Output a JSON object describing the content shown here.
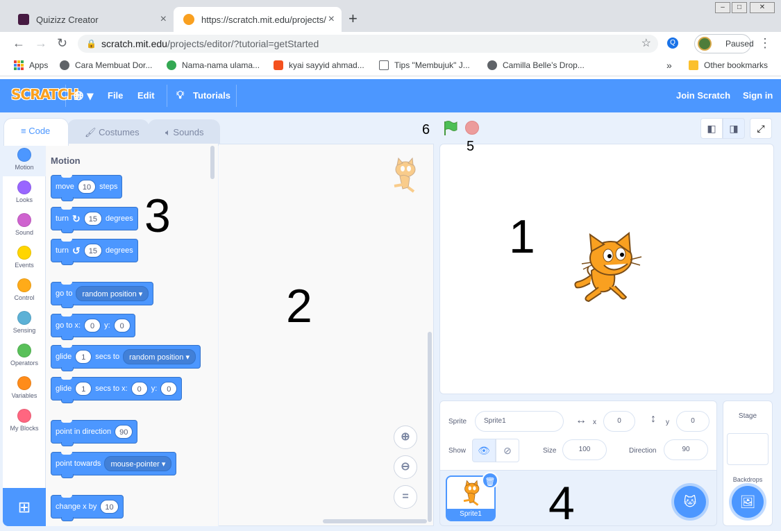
{
  "browser": {
    "tabs": [
      {
        "title": "Quizizz Creator",
        "favicon_color": "#461a42"
      },
      {
        "title": "https://scratch.mit.edu/projects/",
        "favicon_color": "#f9a020"
      }
    ],
    "url_host": "scratch.mit.edu",
    "url_path": "/projects/editor/?tutorial=getStarted",
    "profile_status": "Paused",
    "bookmarks": [
      {
        "label": "Apps"
      },
      {
        "label": "Cara Membuat Dor...",
        "color": "#5f6368"
      },
      {
        "label": "Nama-nama ulama...",
        "color": "#34a853"
      },
      {
        "label": "kyai sayyid ahmad...",
        "color": "#f4511e"
      },
      {
        "label": "Tips \"Membujuk\" J...",
        "color": "#5f6368"
      },
      {
        "label": "Camilla Belle’s Drop...",
        "color": "#5f6368"
      }
    ],
    "other_bookmarks": "Other bookmarks"
  },
  "scratch": {
    "logo": "SCRATCH",
    "menu": {
      "file": "File",
      "edit": "Edit",
      "tutorials": "Tutorials",
      "join": "Join Scratch",
      "signin": "Sign in"
    },
    "editor_tabs": {
      "code": "Code",
      "costumes": "Costumes",
      "sounds": "Sounds"
    },
    "categories": [
      {
        "label": "Motion",
        "color": "#4c97ff"
      },
      {
        "label": "Looks",
        "color": "#9966ff"
      },
      {
        "label": "Sound",
        "color": "#cf63cf"
      },
      {
        "label": "Events",
        "color": "#ffd500"
      },
      {
        "label": "Control",
        "color": "#ffab19"
      },
      {
        "label": "Sensing",
        "color": "#5cb1d6"
      },
      {
        "label": "Operators",
        "color": "#59c059"
      },
      {
        "label": "Variables",
        "color": "#ff8c1a"
      },
      {
        "label": "My Blocks",
        "color": "#ff6680"
      }
    ],
    "palette_title": "Motion",
    "blocks": {
      "move": {
        "a": "move",
        "v": "10",
        "b": "steps"
      },
      "turn_cw": {
        "a": "turn",
        "v": "15",
        "b": "degrees"
      },
      "turn_ccw": {
        "a": "turn",
        "v": "15",
        "b": "degrees"
      },
      "goto": {
        "a": "go to",
        "dd": "random position"
      },
      "gotoxy": {
        "a": "go to x:",
        "x": "0",
        "y_lbl": "y:",
        "y": "0"
      },
      "glide_to": {
        "a": "glide",
        "v": "1",
        "b": "secs to",
        "dd": "random position"
      },
      "glide_xy": {
        "a": "glide",
        "v": "1",
        "b": "secs to x:",
        "x": "0",
        "y_lbl": "y:",
        "y": "0"
      },
      "point_dir": {
        "a": "point in direction",
        "v": "90"
      },
      "point_towards": {
        "a": "point towards",
        "dd": "mouse-pointer"
      },
      "change_x": {
        "a": "change x by",
        "v": "10"
      }
    },
    "sprite_info": {
      "sprite_label": "Sprite",
      "sprite_name": "Sprite1",
      "x_label": "x",
      "x": "0",
      "y_label": "y",
      "y": "0",
      "show_label": "Show",
      "size_label": "Size",
      "size": "100",
      "direction_label": "Direction",
      "direction": "90"
    },
    "sprite_tile": "Sprite1",
    "stage_pane": {
      "title": "Stage",
      "backdrops": "Backdrops"
    }
  },
  "annotations": {
    "n1": "1",
    "n2": "2",
    "n3": "3",
    "n4": "4",
    "n5": "5",
    "n6": "6"
  }
}
